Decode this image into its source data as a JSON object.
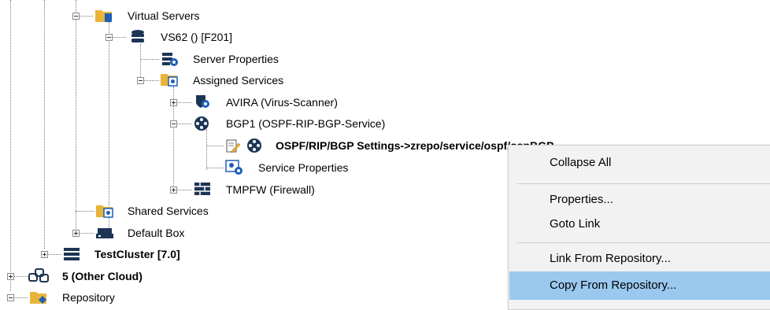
{
  "tree": {
    "virtual_servers": "Virtual Servers",
    "vs62": "VS62 () [F201]",
    "server_properties": "Server Properties",
    "assigned_services": "Assigned Services",
    "avira": "AVIRA (Virus-Scanner)",
    "bgp1": "BGP1 (OSPF-RIP-BGP-Service)",
    "ospf_settings": "OSPF/RIP/BGP Settings->zrepo/service/ospf/ospBGP",
    "service_properties": "Service Properties",
    "tmpfw": "TMPFW (Firewall)",
    "shared_services": "Shared Services",
    "default_box": "Default Box",
    "testcluster": "TestCluster [7.0]",
    "other_cloud": "5 (Other Cloud)",
    "repository": "Repository"
  },
  "context_menu": {
    "items": [
      "Collapse All",
      "Properties...",
      "Goto Link",
      "Link From Repository...",
      "Copy From Repository..."
    ],
    "highlighted": "Copy From Repository..."
  },
  "colors": {
    "folder": "#e8b43a",
    "blue_icon": "#1f5fb5",
    "navy_icon": "#1c3554",
    "menu_bg": "#f2f2f2",
    "menu_highlight": "#9ac8ee"
  }
}
